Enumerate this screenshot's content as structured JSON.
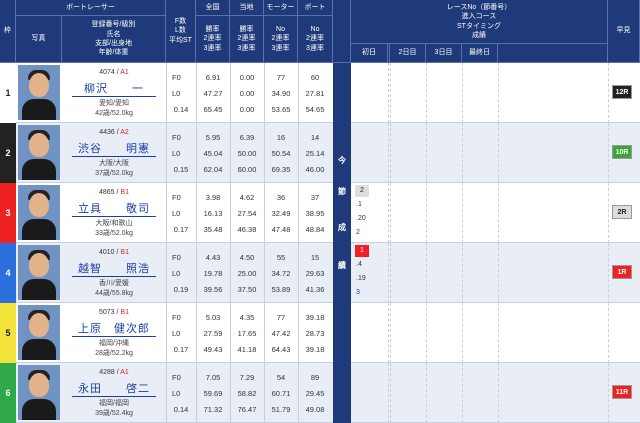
{
  "headers": {
    "lane": "枠",
    "photo": "写真",
    "boatracer": "ボートレーサー",
    "racer_info": "登録番号/級別\n氏名\n支部/出身地\n年齢/体重",
    "f_l_st": "F数\nL数\n平均ST",
    "national": "全国",
    "local": "当地",
    "motor": "モーター",
    "boat": "ボート",
    "rates": "勝率\n2連率\n3連率",
    "no_rates": "No\n2連率\n3連率",
    "series": "レースNo（節番号）\n進入コース\nSTタイミング\n成績",
    "days": [
      "初日",
      "2日目",
      "3日目",
      "最終日"
    ],
    "zenso": "早見",
    "kon_setsu": [
      "今",
      "節",
      "成",
      "績"
    ]
  },
  "racers": [
    {
      "lane": "1",
      "reg": "4074",
      "cls": "A1",
      "name": "柳沢　　一",
      "branch": "愛知/愛知",
      "age": "42歳/52.0kg",
      "f": "F0",
      "l": "L0",
      "st": "0.14",
      "nat": [
        "6.91",
        "47.27",
        "65.45"
      ],
      "loc": [
        "0.00",
        "0.00",
        "0.00"
      ],
      "motor": [
        "77",
        "34.90",
        "53.65"
      ],
      "boat": [
        "60",
        "27.81",
        "54.65"
      ],
      "zenso": "12R",
      "zenso_color": "#222",
      "laneColor": "#fff",
      "laneText": "#222"
    },
    {
      "lane": "2",
      "reg": "4436",
      "cls": "A2",
      "name": "渋谷　　明憲",
      "branch": "大阪/大阪",
      "age": "37歳/52.0kg",
      "f": "F0",
      "l": "L0",
      "st": "0.15",
      "nat": [
        "5.95",
        "45.04",
        "62.04"
      ],
      "loc": [
        "6.39",
        "50.00",
        "60.00"
      ],
      "motor": [
        "16",
        "50.54",
        "69.35"
      ],
      "boat": [
        "14",
        "25.14",
        "46.00"
      ],
      "zenso": "10R",
      "zenso_color": "#3aa63a",
      "laneColor": "#222",
      "laneText": "#fff"
    },
    {
      "lane": "3",
      "reg": "4865",
      "cls": "B1",
      "name": "立具　　敬司",
      "branch": "大阪/和歌山",
      "age": "33歳/52.0kg",
      "f": "F0",
      "l": "L0",
      "st": "0.17",
      "nat": [
        "3.98",
        "16.13",
        "35.48"
      ],
      "loc": [
        "4.62",
        "27.54",
        "46.38"
      ],
      "motor": [
        "36",
        "32.49",
        "47.48"
      ],
      "boat": [
        "37",
        "38.95",
        "48.84"
      ],
      "zenso": "2R",
      "zenso_color": "#ddd",
      "laneColor": "#e22",
      "laneText": "#fff",
      "st_entries": [
        "2",
        ".1",
        ".20",
        "2"
      ]
    },
    {
      "lane": "4",
      "reg": "4010",
      "cls": "B1",
      "name": "越智　　照浩",
      "branch": "香川/愛媛",
      "age": "44歳/55.8kg",
      "f": "F0",
      "l": "L0",
      "st": "0.19",
      "nat": [
        "4.43",
        "19.78",
        "39.56"
      ],
      "loc": [
        "4.50",
        "25.00",
        "37.50"
      ],
      "motor": [
        "55",
        "34.72",
        "53.89"
      ],
      "boat": [
        "15",
        "29.63",
        "41.36"
      ],
      "zenso": "1R",
      "zenso_color": "#e22",
      "laneColor": "#2a6fdb",
      "laneText": "#fff",
      "st_entries": [
        "1",
        ".4",
        ".19",
        "3"
      ]
    },
    {
      "lane": "5",
      "reg": "5073",
      "cls": "B1",
      "name": "上原　健次郎",
      "branch": "福岡/沖縄",
      "age": "28歳/52.2kg",
      "f": "F0",
      "l": "L0",
      "st": "0.17",
      "nat": [
        "5.03",
        "27.59",
        "49.43"
      ],
      "loc": [
        "4.35",
        "17.65",
        "41.18"
      ],
      "motor": [
        "77",
        "47.42",
        "64.43"
      ],
      "boat": [
        "39.18",
        "28.73",
        "39.18"
      ],
      "zenso": "",
      "zenso_color": "#fff",
      "laneColor": "#f3e23a",
      "laneText": "#222"
    },
    {
      "lane": "6",
      "reg": "4288",
      "cls": "A1",
      "name": "永田　　啓二",
      "branch": "福岡/福岡",
      "age": "39歳/52.4kg",
      "f": "F0",
      "l": "L0",
      "st": "0.14",
      "nat": [
        "7.05",
        "59.69",
        "71.32"
      ],
      "loc": [
        "7.29",
        "58.82",
        "76.47"
      ],
      "motor": [
        "54",
        "60.71",
        "51.79"
      ],
      "boat": [
        "89",
        "29.45",
        "49.08"
      ],
      "zenso": "11R",
      "zenso_color": "#e22",
      "laneColor": "#2fa84a",
      "laneText": "#fff"
    }
  ]
}
